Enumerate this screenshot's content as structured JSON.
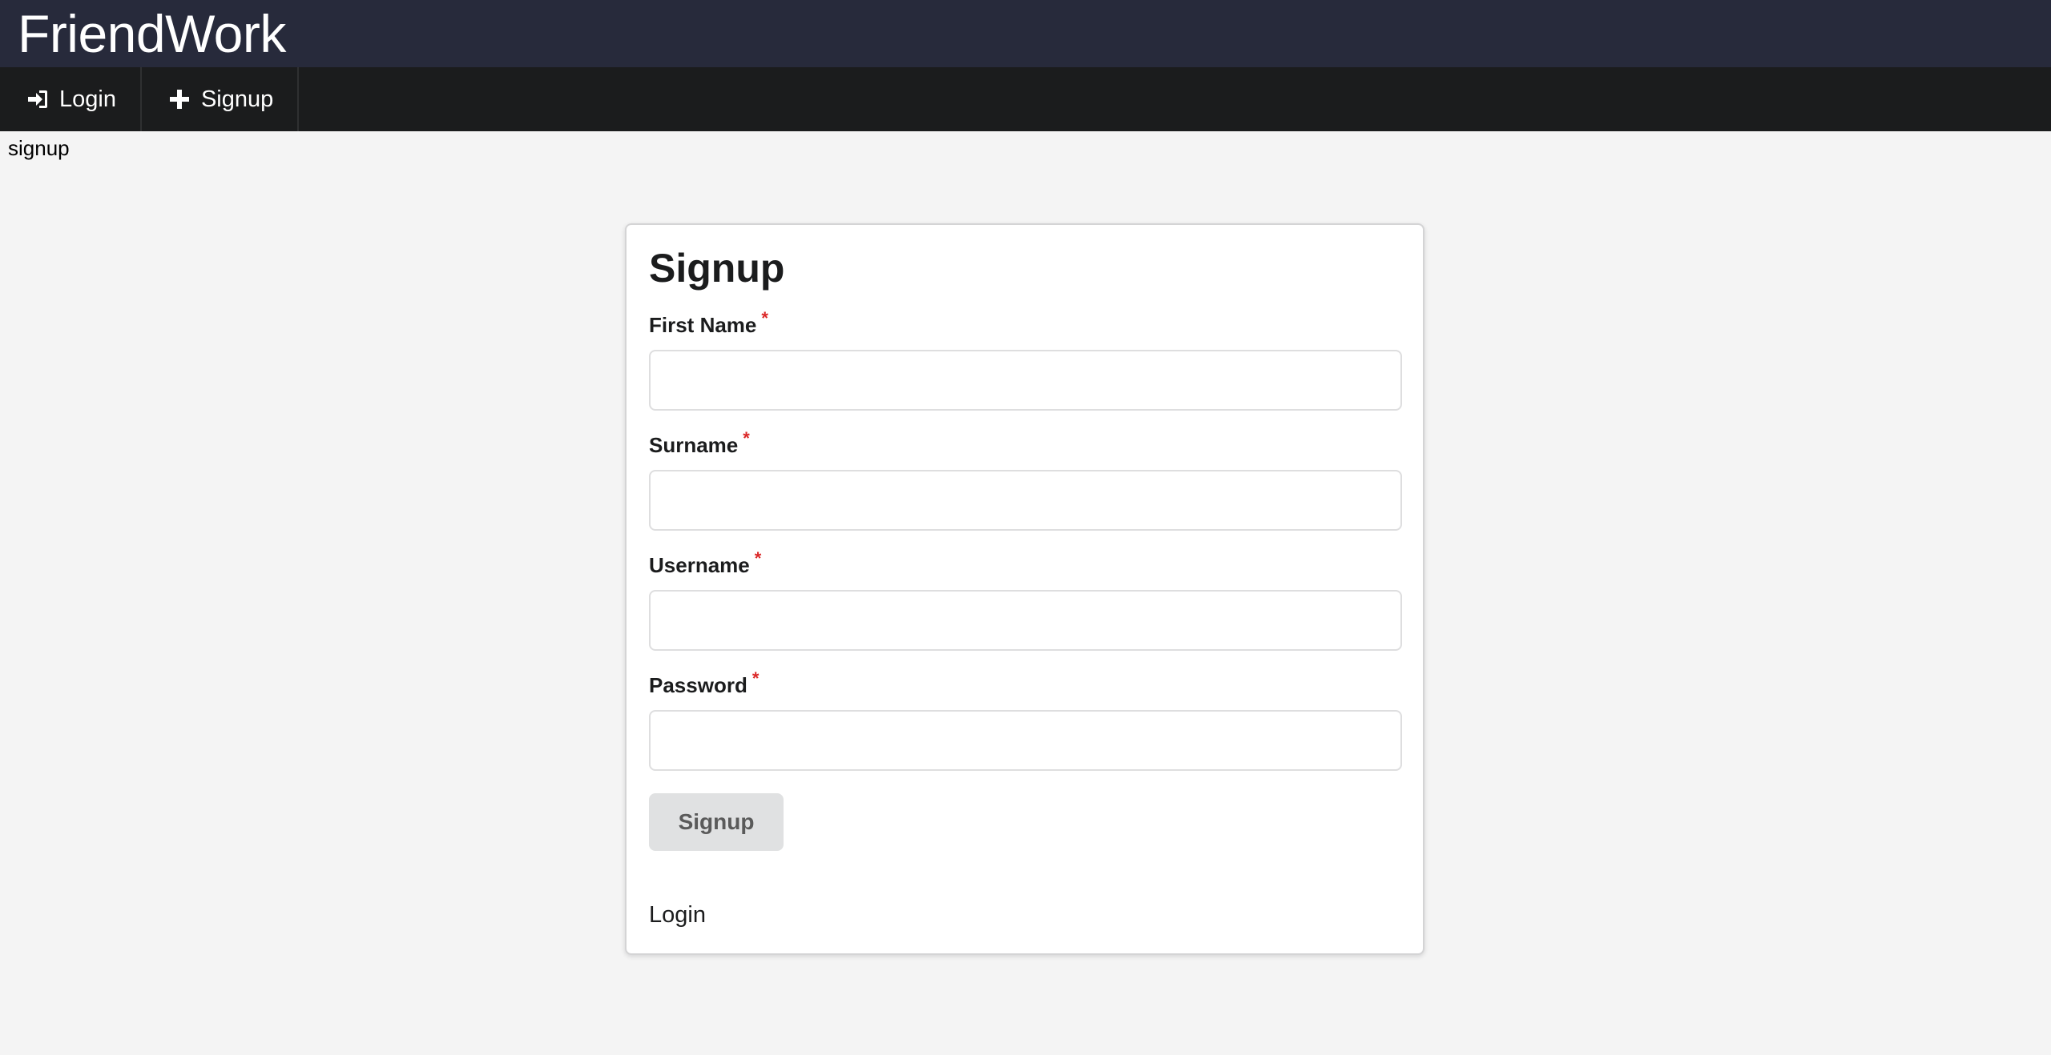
{
  "app": {
    "title": "FriendWork"
  },
  "menu": {
    "items": [
      {
        "label": "Login",
        "icon": "sign-in-icon"
      },
      {
        "label": "Signup",
        "icon": "plus-icon"
      }
    ]
  },
  "route": {
    "label": "signup"
  },
  "form": {
    "title": "Signup",
    "required_marker": "*",
    "fields": [
      {
        "label": "First Name",
        "value": "",
        "placeholder": ""
      },
      {
        "label": "Surname",
        "value": "",
        "placeholder": ""
      },
      {
        "label": "Username",
        "value": "",
        "placeholder": ""
      },
      {
        "label": "Password",
        "value": "",
        "placeholder": ""
      }
    ],
    "submit_label": "Signup",
    "login_link": "Login"
  },
  "colors": {
    "title_bar": "#272a3b",
    "menu_bar": "#1b1c1d",
    "background": "#f4f4f4",
    "required": "#db2828",
    "button": "#e0e1e2"
  }
}
